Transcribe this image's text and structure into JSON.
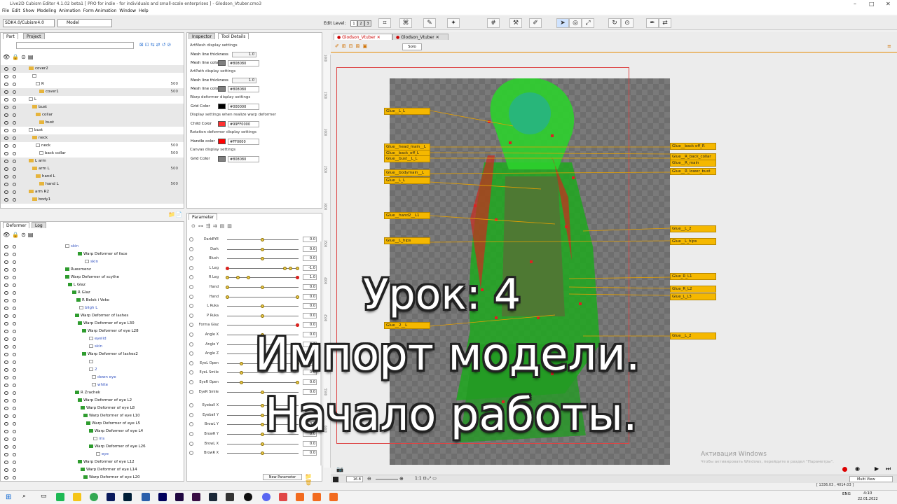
{
  "window": {
    "title": "Live2D Cubism Editor 4.1.02 beta1   [ PRO for indie - for individuals and small-scale enterprises ]  - Glodson_Vtuber.cmo3"
  },
  "menu": [
    "File",
    "Edit",
    "Show",
    "Modeling",
    "Animation",
    "Form Animation",
    "Window",
    "Help"
  ],
  "toolbar": {
    "version_combo": "SDK4.0/Cubism4.0",
    "mode_combo": "Model",
    "edit_level_label": "Edit Level:",
    "edit_levels": [
      "1",
      "2",
      "3"
    ]
  },
  "left_top": {
    "tabs": [
      "Part",
      "Project"
    ],
    "rows": [
      {
        "label": "cover2",
        "icon": "folder",
        "value": ""
      },
      {
        "label": "",
        "icon": "mesh",
        "value": ""
      },
      {
        "label": "R",
        "icon": "mesh",
        "value": "500"
      },
      {
        "label": "cover1",
        "icon": "folder",
        "value": "500"
      },
      {
        "label": "L",
        "icon": "mesh",
        "value": ""
      },
      {
        "label": "bust",
        "icon": "folder",
        "value": ""
      },
      {
        "label": "collar",
        "icon": "folder",
        "value": ""
      },
      {
        "label": "bust",
        "icon": "folder",
        "value": ""
      },
      {
        "label": "bust",
        "icon": "mesh",
        "value": ""
      },
      {
        "label": "neck",
        "icon": "folder",
        "value": ""
      },
      {
        "label": "neck",
        "icon": "mesh",
        "value": "500"
      },
      {
        "label": "back collar",
        "icon": "mesh",
        "value": "500"
      },
      {
        "label": "L arm",
        "icon": "folder",
        "value": ""
      },
      {
        "label": "arm L",
        "icon": "folder",
        "value": "500"
      },
      {
        "label": "hand L",
        "icon": "folder",
        "value": ""
      },
      {
        "label": "hand L",
        "icon": "folder",
        "value": "500"
      },
      {
        "label": "arm R2",
        "icon": "folder",
        "value": ""
      },
      {
        "label": "body1",
        "icon": "folder",
        "value": ""
      }
    ]
  },
  "left_bottom": {
    "tabs": [
      "Deformer",
      "Log"
    ],
    "rows": [
      {
        "label": "skin",
        "icon": "box",
        "indent": 92
      },
      {
        "label": "Warp Deformer of face",
        "icon": "green",
        "indent": 110
      },
      {
        "label": "skin",
        "icon": "box",
        "indent": 120
      },
      {
        "label": "Ruexmenz",
        "icon": "green",
        "indent": 92
      },
      {
        "label": "Warp Deformer of scythe",
        "icon": "green",
        "indent": 92
      },
      {
        "label": "L Glaz",
        "icon": "green",
        "indent": 96
      },
      {
        "label": "R Glaz",
        "icon": "green",
        "indent": 102
      },
      {
        "label": "R Belok i Veko",
        "icon": "green",
        "indent": 108
      },
      {
        "label": "bligh L",
        "icon": "box",
        "indent": 112
      },
      {
        "label": "Warp Deformer of lashes",
        "icon": "green",
        "indent": 106
      },
      {
        "label": "Warp Deformer of eye L30",
        "icon": "green",
        "indent": 110
      },
      {
        "label": "Warp Deformer of eye L28",
        "icon": "green",
        "indent": 116
      },
      {
        "label": "eyelid",
        "icon": "box",
        "indent": 126
      },
      {
        "label": "skin",
        "icon": "box",
        "indent": 126
      },
      {
        "label": "Warp Deformer of lashes2",
        "icon": "green",
        "indent": 116
      },
      {
        "label": "",
        "icon": "box",
        "indent": 126
      },
      {
        "label": "2",
        "icon": "box",
        "indent": 126
      },
      {
        "label": "down eye",
        "icon": "box",
        "indent": 130
      },
      {
        "label": "white",
        "icon": "box",
        "indent": 130
      },
      {
        "label": "R Zrachek",
        "icon": "green",
        "indent": 106
      },
      {
        "label": "Warp Deformer of eye L2",
        "icon": "green",
        "indent": 110
      },
      {
        "label": "Warp Deformer of eye L8",
        "icon": "green",
        "indent": 114
      },
      {
        "label": "Warp Deformer of eye L10",
        "icon": "green",
        "indent": 118
      },
      {
        "label": "Warp Deformer of eye L5",
        "icon": "green",
        "indent": 122
      },
      {
        "label": "Warp Deformer of eye L4",
        "icon": "green",
        "indent": 126
      },
      {
        "label": "iris",
        "icon": "box",
        "indent": 132
      },
      {
        "label": "Warp Deformer of eye L26",
        "icon": "green",
        "indent": 126
      },
      {
        "label": "eye",
        "icon": "box",
        "indent": 136
      },
      {
        "label": "Warp Deformer of eye L12",
        "icon": "green",
        "indent": 110
      },
      {
        "label": "Warp Deformer of eye L14",
        "icon": "green",
        "indent": 114
      },
      {
        "label": "Warp Deformer of eye L20",
        "icon": "green",
        "indent": 118
      }
    ]
  },
  "tool_details": {
    "tabs": [
      "Inspector",
      "Tool Details"
    ],
    "sections": [
      {
        "title": "ArtMesh display settings",
        "items": [
          {
            "label": "Mesh line thickness",
            "value": "1.0"
          },
          {
            "label": "Mesh line color",
            "hex": "#808080",
            "color": "#808080"
          }
        ]
      },
      {
        "title": "ArtPath display settings",
        "items": [
          {
            "label": "Mesh line thickness",
            "value": "1.0"
          },
          {
            "label": "Mesh line color",
            "hex": "#808080",
            "color": "#808080"
          }
        ]
      },
      {
        "title": "Warp deformer display settings",
        "items": [
          {
            "label": "Grid Color",
            "hex": "#000000",
            "color": "#000000"
          }
        ]
      },
      {
        "title": "Display settings when realize warp deformer",
        "items": [
          {
            "label": "Child Color",
            "hex": "#99FF0000",
            "color": "#ff3030"
          }
        ]
      },
      {
        "title": "Rotation deformer display settings",
        "items": [
          {
            "label": "Handle color",
            "hex": "#FF0000",
            "color": "#ff0000"
          }
        ]
      },
      {
        "title": "Canvas display settings",
        "items": [
          {
            "label": "Grid Color",
            "hex": "#808080",
            "color": "#808080"
          }
        ]
      }
    ]
  },
  "parameters": {
    "tab": "Parameter",
    "new_parameter": "New Parameter",
    "rows": [
      {
        "name": "DarkEYE",
        "value": "0.0"
      },
      {
        "name": "Dark",
        "value": "0.0"
      },
      {
        "name": "Blush",
        "value": "0.0"
      },
      {
        "name": "L Leg",
        "value": "-1.0"
      },
      {
        "name": "R Leg",
        "value": "1.0"
      },
      {
        "name": "Hand",
        "value": "0.0"
      },
      {
        "name": "Hand",
        "value": "0.0"
      },
      {
        "name": "L Ruka",
        "value": "0.0"
      },
      {
        "name": "P Ruka",
        "value": "0.0"
      },
      {
        "name": "Forma Glaz",
        "value": "0.0"
      },
      {
        "name": "Angle X",
        "value": "0.0"
      },
      {
        "name": "Angle Y",
        "value": "0.0"
      },
      {
        "name": "Angle Z",
        "value": "0.0"
      },
      {
        "name": "EyeL Open",
        "value": "0.0"
      },
      {
        "name": "EyeL Smile",
        "value": "0.0"
      },
      {
        "name": "EyeR Open",
        "value": "0.0"
      },
      {
        "name": "EyeR Smile",
        "value": "0.0"
      },
      {
        "name": "Eyeball X",
        "value": ""
      },
      {
        "name": "Eyeball Y",
        "value": ""
      },
      {
        "name": "BrowL Y",
        "value": "0.0"
      },
      {
        "name": "BrowR Y",
        "value": "0.0"
      },
      {
        "name": "BrowL X",
        "value": "0.0"
      },
      {
        "name": "BrowR X",
        "value": "0.0"
      }
    ]
  },
  "viewport": {
    "tabs": [
      "Glodson_Vtuber",
      "Glodson_Vtuber"
    ],
    "solo_label": "Solo",
    "zoom": "16.8",
    "view_mode": "Multi View",
    "coords": "[ 1336.03 , 4014.03 ]",
    "glue_left": [
      "Glue__L_L",
      "Glue__head_main__L",
      "Glue__back_off_L",
      "Glue__bust__L_L",
      "Glue__bodymain__L",
      "Glue__L_L",
      "Glue__hand2__L1",
      "Glue__L_hips",
      "Glue__2__L"
    ],
    "glue_right": [
      "Glue__back off_R",
      "Glue__R_back_collar",
      "Glue__R_main",
      "Glue__R_lower_bust",
      "Glue__L_2",
      "Glue__L_hips",
      "Glue_R_L1",
      "Glue_R_L2",
      "Glue_L_L3",
      "Glue__L_2"
    ],
    "ruler_left": [
      "1000",
      "1500",
      "2000",
      "2500",
      "3000",
      "3500",
      "4000",
      "4500",
      "5000",
      "5500",
      "6000"
    ]
  },
  "overlay": {
    "lesson": "Урок: 4",
    "title_line1": "Импорт модели.",
    "title_line2": "Начало работы."
  },
  "watermark": {
    "line1": "Активация Windows",
    "line2": "Чтобы активировать Windows, перейдите в раздел \"Параметры\"."
  },
  "taskbar": {
    "time": "4:10",
    "date": "22.01.2022",
    "lang": "ENG"
  }
}
